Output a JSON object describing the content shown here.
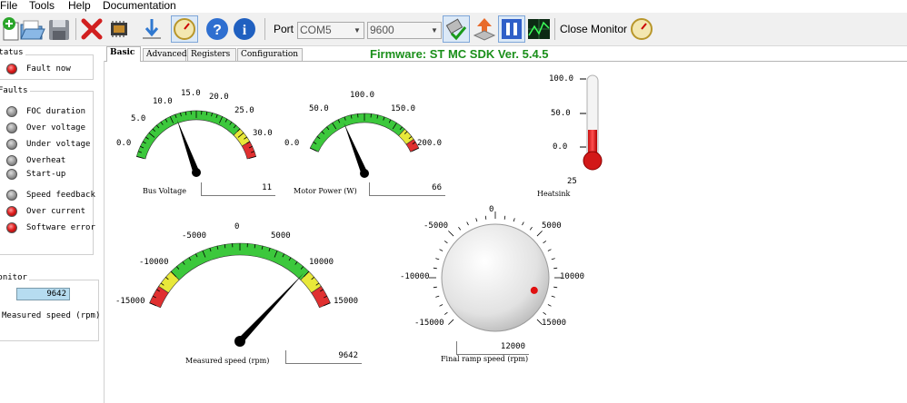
{
  "menu": [
    "File",
    "Tools",
    "Help",
    "Documentation"
  ],
  "toolbar": {
    "port_label": "Port",
    "port_value": "COM5",
    "baud_value": "9600",
    "close_monitor_label": "Close Monitor",
    "icons": [
      "new-icon",
      "open-icon",
      "save-icon",
      "delete-icon",
      "chip-icon",
      "download-icon",
      "monitor-gauge-icon",
      "help-icon",
      "info-icon",
      "connect-icon",
      "upload-icon",
      "pause-icon",
      "oscilloscope-icon",
      "close-monitor-icon"
    ]
  },
  "left": {
    "status_title": "Status",
    "fault_now": "Fault now",
    "faults_title": "Faults",
    "faults": [
      {
        "label": "FOC duration",
        "state": "gray"
      },
      {
        "label": "Over voltage",
        "state": "gray"
      },
      {
        "label": "Under voltage",
        "state": "gray"
      },
      {
        "label": "Overheat",
        "state": "gray"
      },
      {
        "label": "Start-up",
        "state": "gray"
      },
      {
        "label": "Speed feedback",
        "state": "gray"
      },
      {
        "label": "Over current",
        "state": "red"
      },
      {
        "label": "Software error",
        "state": "red"
      }
    ],
    "monitor_title": "Monitor",
    "monitor_value": "9642",
    "monitor_label": "Measured speed (rpm)"
  },
  "tabs": [
    "Basic",
    "Advanced",
    "Registers",
    "Configuration"
  ],
  "firmware": "Firmware: ST MC SDK Ver. 5.4.5",
  "gauges": {
    "bus_voltage": {
      "label": "Bus Voltage",
      "value": "11",
      "ticks": [
        "0.0",
        "5.0",
        "10.0",
        "15.0",
        "20.0",
        "25.0",
        "30.0"
      ]
    },
    "motor_power": {
      "label": "Motor Power (W)",
      "value": "66",
      "ticks": [
        "0.0",
        "50.0",
        "100.0",
        "150.0",
        "200.0"
      ]
    },
    "heatsink": {
      "label": "Heatsink",
      "value": "25",
      "ticks": [
        "100.0",
        "50.0",
        "0.0"
      ]
    },
    "measured_speed": {
      "label": "Measured speed (rpm)",
      "value": "9642",
      "ticks": [
        "-15000",
        "-10000",
        "-5000",
        "0",
        "5000",
        "10000",
        "15000"
      ]
    },
    "final_ramp": {
      "label": "Final ramp speed (rpm)",
      "value": "12000",
      "ticks": [
        "-15000",
        "-10000",
        "-5000",
        "0",
        "5000",
        "10000",
        "15000"
      ]
    }
  },
  "colors": {
    "accent_green": "#1a8f1a",
    "gauge_green": "#3cc83c",
    "gauge_yellow": "#e8e83a",
    "gauge_red": "#e03030",
    "readout_bg": "#b6dcf0"
  }
}
